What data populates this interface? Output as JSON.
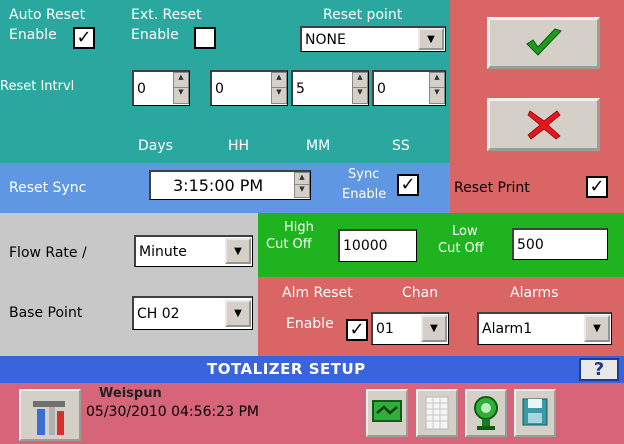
{
  "auto_reset": {
    "label1": "Auto Reset",
    "label2": "Enable",
    "checked_glyph": "✓"
  },
  "ext_reset": {
    "label1": "Ext. Reset",
    "label2": "Enable"
  },
  "reset_point": {
    "label": "Reset point",
    "value": "NONE"
  },
  "reset_interval": {
    "label": "Reset Intrvl",
    "fields": [
      {
        "value": "0",
        "unit": "Days"
      },
      {
        "value": "0",
        "unit": "HH"
      },
      {
        "value": "5",
        "unit": "MM"
      },
      {
        "value": "0",
        "unit": "SS"
      }
    ]
  },
  "reset_sync": {
    "label": "Reset Sync",
    "value": "3:15:00 PM"
  },
  "sync_enable": {
    "label1": "Sync",
    "label2": "Enable",
    "checked_glyph": "✓"
  },
  "reset_print": {
    "label": "Reset Print",
    "checked_glyph": "✓"
  },
  "flow_rate": {
    "label": "Flow Rate /",
    "value": "Minute"
  },
  "base_point": {
    "label": "Base Point",
    "value": "CH 02"
  },
  "high_cut_off": {
    "label1": "High",
    "label2": "Cut Off",
    "value": "10000"
  },
  "low_cut_off": {
    "label1": "Low",
    "label2": "Cut Off",
    "value": "500"
  },
  "alarm": {
    "alm_reset_label1": "Alm Reset",
    "alm_reset_label2": "Enable",
    "checked_glyph": "✓",
    "chan_label": "Chan",
    "chan_value": "01",
    "alarms_label": "Alarms",
    "alarms_value": "Alarm1"
  },
  "title": "TOTALIZER SETUP",
  "help": "?",
  "status": {
    "brand": "Weispun",
    "datetime": "05/30/2010 04:56:23 PM"
  },
  "colors": {
    "teal": "#2aa8a0",
    "red_panel": "#d96565",
    "blue_panel": "#5f97e3",
    "green_panel": "#1fb31f",
    "title_bar": "#3a64de",
    "status_bar": "#d6657a",
    "ok_check": "#1f9a1f",
    "cancel_x": "#e8141e"
  },
  "icons": [
    "ok-check-icon",
    "cancel-x-icon",
    "tools-icon",
    "channel-icon",
    "grid-icon",
    "alarm-bell-icon",
    "save-disk-icon"
  ]
}
